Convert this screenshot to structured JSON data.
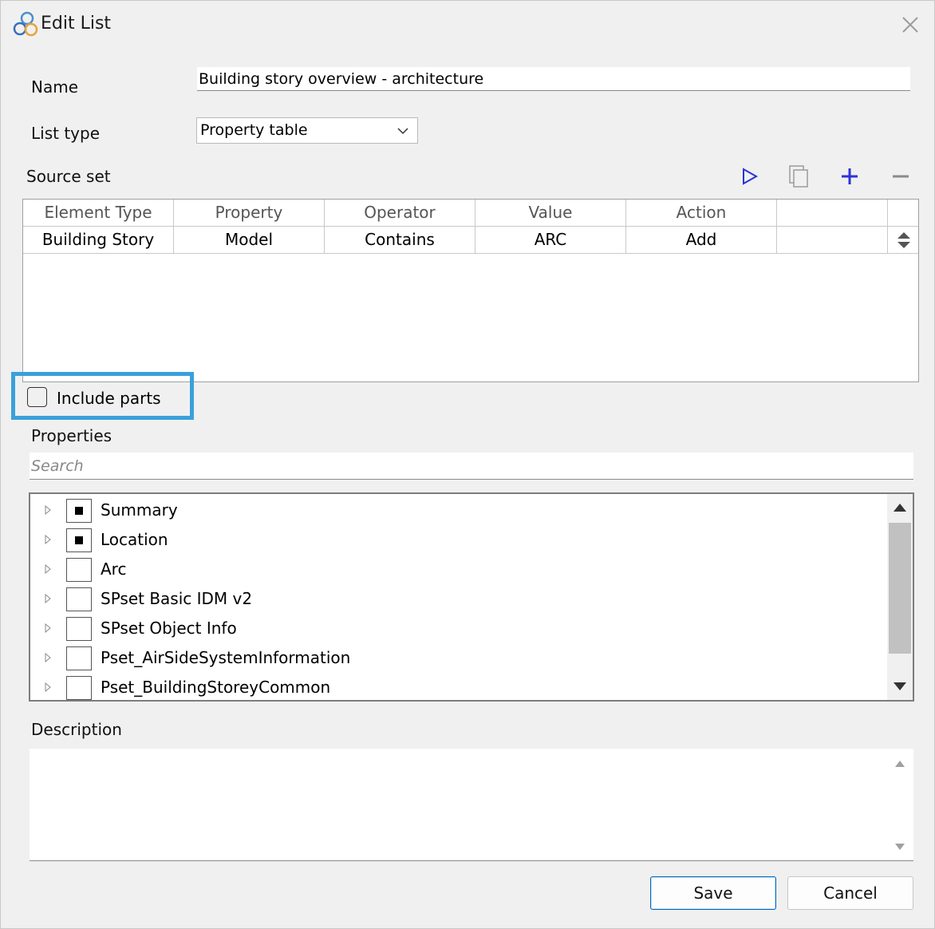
{
  "window": {
    "title": "Edit List",
    "accent_color": "#3aa0db",
    "action_color": "#2b33d6"
  },
  "form": {
    "name_label": "Name",
    "name_value": "Building story overview - architecture",
    "list_type_label": "List type",
    "list_type_value": "Property table",
    "source_set_label": "Source set"
  },
  "toolbar": {
    "icons": [
      "play-icon",
      "copy-icon",
      "plus-icon",
      "minus-icon"
    ]
  },
  "source_grid": {
    "columns": [
      "Element Type",
      "Property",
      "Operator",
      "Value",
      "Action",
      ""
    ],
    "rows": [
      [
        "Building Story",
        "Model",
        "Contains",
        "ARC",
        "Add",
        ""
      ]
    ]
  },
  "include_parts": {
    "label": "Include parts",
    "checked": false
  },
  "properties": {
    "label": "Properties",
    "search_placeholder": "Search",
    "items": [
      {
        "label": "Summary",
        "state": "partial"
      },
      {
        "label": "Location",
        "state": "partial"
      },
      {
        "label": "Arc",
        "state": "unchecked"
      },
      {
        "label": "SPset Basic IDM v2",
        "state": "unchecked"
      },
      {
        "label": "SPset Object Info",
        "state": "unchecked"
      },
      {
        "label": "Pset_AirSideSystemInformation",
        "state": "unchecked"
      },
      {
        "label": "Pset_BuildingStoreyCommon",
        "state": "unchecked"
      }
    ]
  },
  "description": {
    "label": "Description",
    "value": ""
  },
  "buttons": {
    "save": "Save",
    "cancel": "Cancel"
  }
}
